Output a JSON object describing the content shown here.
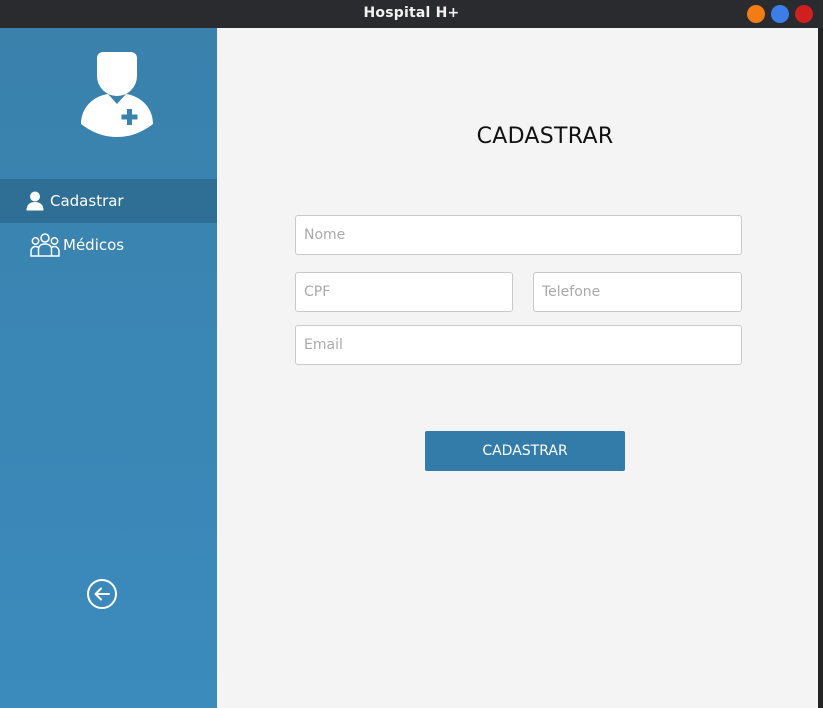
{
  "window": {
    "title": "Hospital H+",
    "controls": [
      "minimize",
      "maximize",
      "close"
    ]
  },
  "colors": {
    "titlebar": "#2a2b2f",
    "sidebar": "#3a85b4",
    "sidebar_active": "#2f6f96",
    "main_background": "#f4f4f4",
    "button": "#337ba8",
    "minimize": "#f47c14",
    "maximize": "#3b7ee8",
    "close": "#d11f1f"
  },
  "sidebar": {
    "avatar_icon": "doctor-avatar-icon",
    "items": [
      {
        "label": "Cadastrar",
        "icon": "user-icon",
        "active": true
      },
      {
        "label": "Médicos",
        "icon": "group-icon",
        "active": false
      }
    ],
    "back_icon": "arrow-left-circle-icon"
  },
  "form": {
    "title": "CADASTRAR",
    "fields": {
      "nome": {
        "placeholder": "Nome",
        "value": ""
      },
      "cpf": {
        "placeholder": "CPF",
        "value": ""
      },
      "telefone": {
        "placeholder": "Telefone",
        "value": ""
      },
      "email": {
        "placeholder": "Email",
        "value": ""
      }
    },
    "submit_label": "CADASTRAR"
  }
}
